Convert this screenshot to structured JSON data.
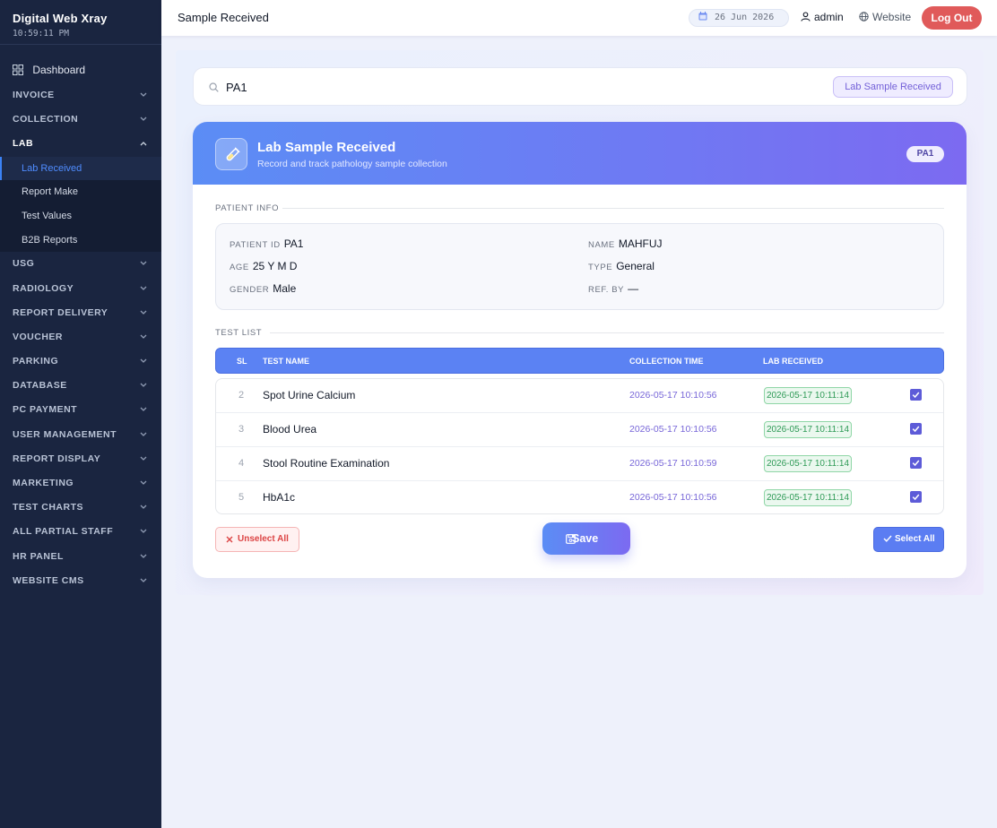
{
  "sidebar": {
    "brand": "Digital Web Xray",
    "time": "10:59:11 PM",
    "dashboard": "Dashboard",
    "groups_top": [
      "INVOICE",
      "COLLECTION"
    ],
    "lab": "LAB",
    "lab_items": [
      "Lab Received",
      "Report Make",
      "Test Values",
      "B2B Reports"
    ],
    "groups_bottom": [
      "USG",
      "RADIOLOGY",
      "REPORT DELIVERY",
      "VOUCHER",
      "PARKING",
      "DATABASE",
      "PC PAYMENT",
      "USER MANAGEMENT",
      "REPORT DISPLAY",
      "MARKETING",
      "TEST CHARTS",
      "ALL PARTIAL STAFF",
      "HR PANEL",
      "WEBSITE CMS"
    ]
  },
  "topbar": {
    "title": "Sample Received",
    "date": "26 Jun 2026",
    "user": "admin",
    "website": "Website",
    "logout": "Log Out"
  },
  "search": {
    "value": "PA1",
    "badge": "Lab Sample Received"
  },
  "card": {
    "title": "Lab Sample Received",
    "subtitle": "Record and track pathology sample collection",
    "badge": "PA1"
  },
  "patient": {
    "section": "PATIENT INFO",
    "id_label": "PATIENT ID",
    "id": "PA1",
    "name_label": "NAME",
    "name": "MAHFUJ",
    "age_label": "AGE",
    "age": "25 Y M D",
    "type_label": "TYPE",
    "type": "General",
    "gender_label": "GENDER",
    "gender": "Male",
    "ref_label": "REF. BY",
    "ref": "—"
  },
  "tests": {
    "section": "TEST LIST",
    "headers": {
      "sl": "SL",
      "name": "TEST NAME",
      "collection": "COLLECTION TIME",
      "received": "LAB RECEIVED"
    },
    "rows": [
      {
        "sl": "2",
        "name": "Spot Urine Calcium",
        "collection": "2026-05-17 10:10:56",
        "received": "2026-05-17 10:11:14",
        "checked": true
      },
      {
        "sl": "3",
        "name": "Blood Urea",
        "collection": "2026-05-17 10:10:56",
        "received": "2026-05-17 10:11:14",
        "checked": true
      },
      {
        "sl": "4",
        "name": "Stool Routine Examination",
        "collection": "2026-05-17 10:10:59",
        "received": "2026-05-17 10:11:14",
        "checked": true
      },
      {
        "sl": "5",
        "name": "HbA1c",
        "collection": "2026-05-17 10:10:56",
        "received": "2026-05-17 10:11:14",
        "checked": true
      }
    ]
  },
  "actions": {
    "unselect": "Unselect All",
    "save": "Save",
    "select": "Select All"
  },
  "colors": {
    "sidebar": "#1a2540",
    "accent": "#5b8df5",
    "logout": "#e05a5a",
    "received": "#2e9a56"
  }
}
